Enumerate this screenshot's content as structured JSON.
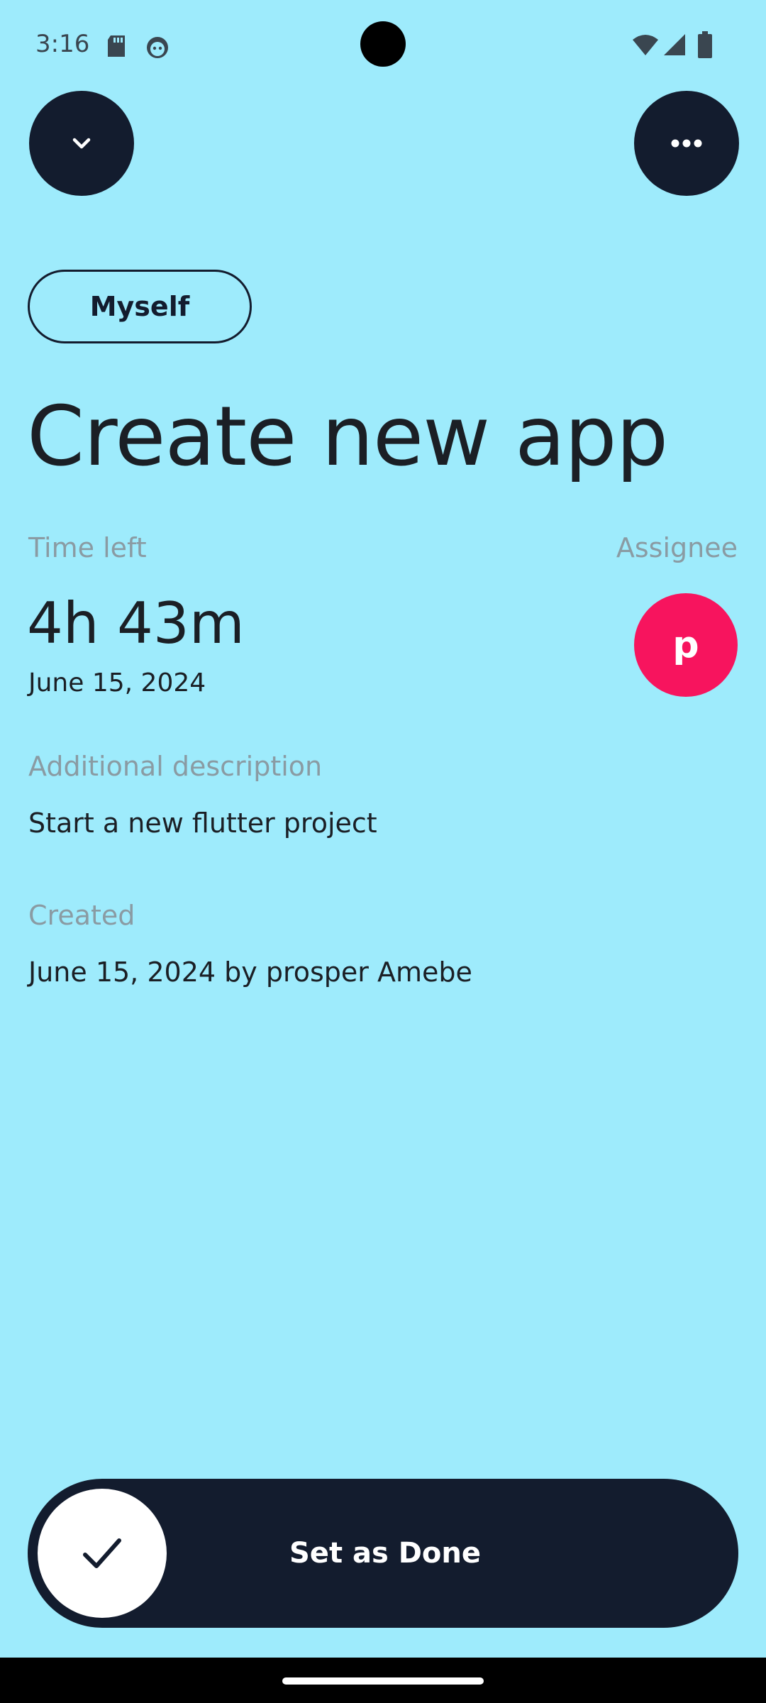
{
  "status_bar": {
    "time": "3:16",
    "icons": [
      "sd-card-icon",
      "face-icon",
      "wifi-icon",
      "signal-icon",
      "battery-icon"
    ]
  },
  "header": {
    "back_icon": "chevron-down-icon",
    "menu_icon": "more-horizontal-icon"
  },
  "task": {
    "category": "Myself",
    "title": "Create new app",
    "time_left_label": "Time left",
    "time_left": "4h 43m",
    "due_date": "June 15, 2024",
    "assignee_label": "Assignee",
    "assignee_initial": "p",
    "description_label": "Additional description",
    "description": "Start a new flutter project",
    "created_label": "Created",
    "created": "June 15, 2024 by prosper Amebe"
  },
  "action": {
    "label": "Set as Done",
    "icon": "check-icon"
  },
  "colors": {
    "background": "#9EEBFC",
    "dark": "#131C2E",
    "accent": "#F7145E",
    "muted": "#8a9ba3"
  }
}
